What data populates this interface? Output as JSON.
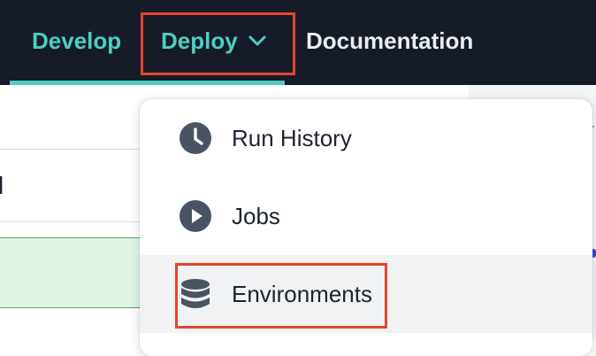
{
  "nav": {
    "develop": "Develop",
    "deploy": "Deploy",
    "documentation": "Documentation"
  },
  "menu": {
    "items": [
      {
        "label": "Run History",
        "icon": "clock-icon"
      },
      {
        "label": "Jobs",
        "icon": "play-icon"
      },
      {
        "label": "Environments",
        "icon": "database-icon"
      }
    ]
  },
  "colors": {
    "nav_bg": "#151c27",
    "accent": "#4ecdc4",
    "highlight": "#e5452a",
    "icon": "#4a5361"
  }
}
